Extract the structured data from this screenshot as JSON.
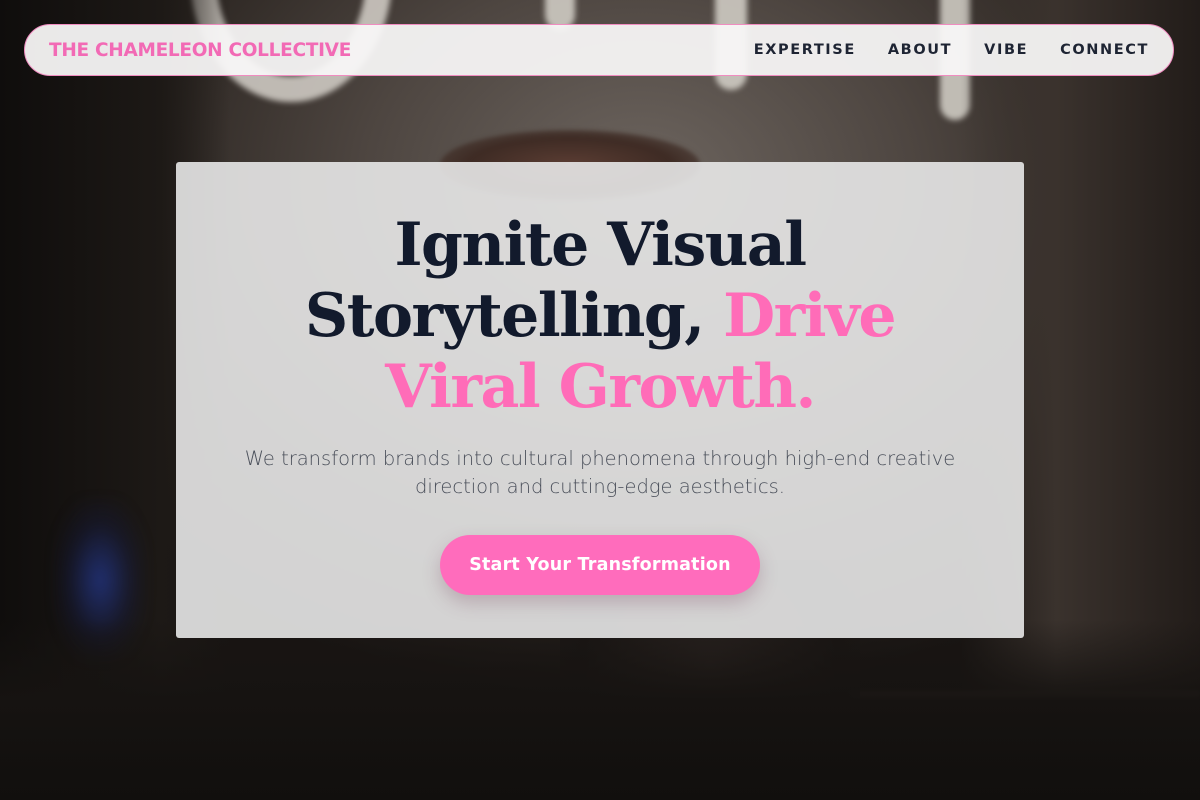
{
  "nav": {
    "brand": "THE CHAMELEON COLLECTIVE",
    "links": [
      {
        "label": "EXPERTISE"
      },
      {
        "label": "ABOUT"
      },
      {
        "label": "VIBE"
      },
      {
        "label": "CONNECT"
      }
    ]
  },
  "hero": {
    "headline_part1": "Ignite Visual Storytelling, ",
    "headline_accent": "Drive Viral Growth.",
    "subtext": "We transform brands into cultural phenomena through high-end creative direction and cutting-edge aesthetics.",
    "cta_label": "Start Your Transformation"
  },
  "colors": {
    "accent_pink": "#ff6cb8",
    "headline_navy": "#121a2c",
    "nav_text": "#1e2433",
    "body_text": "#4a4f5a"
  }
}
